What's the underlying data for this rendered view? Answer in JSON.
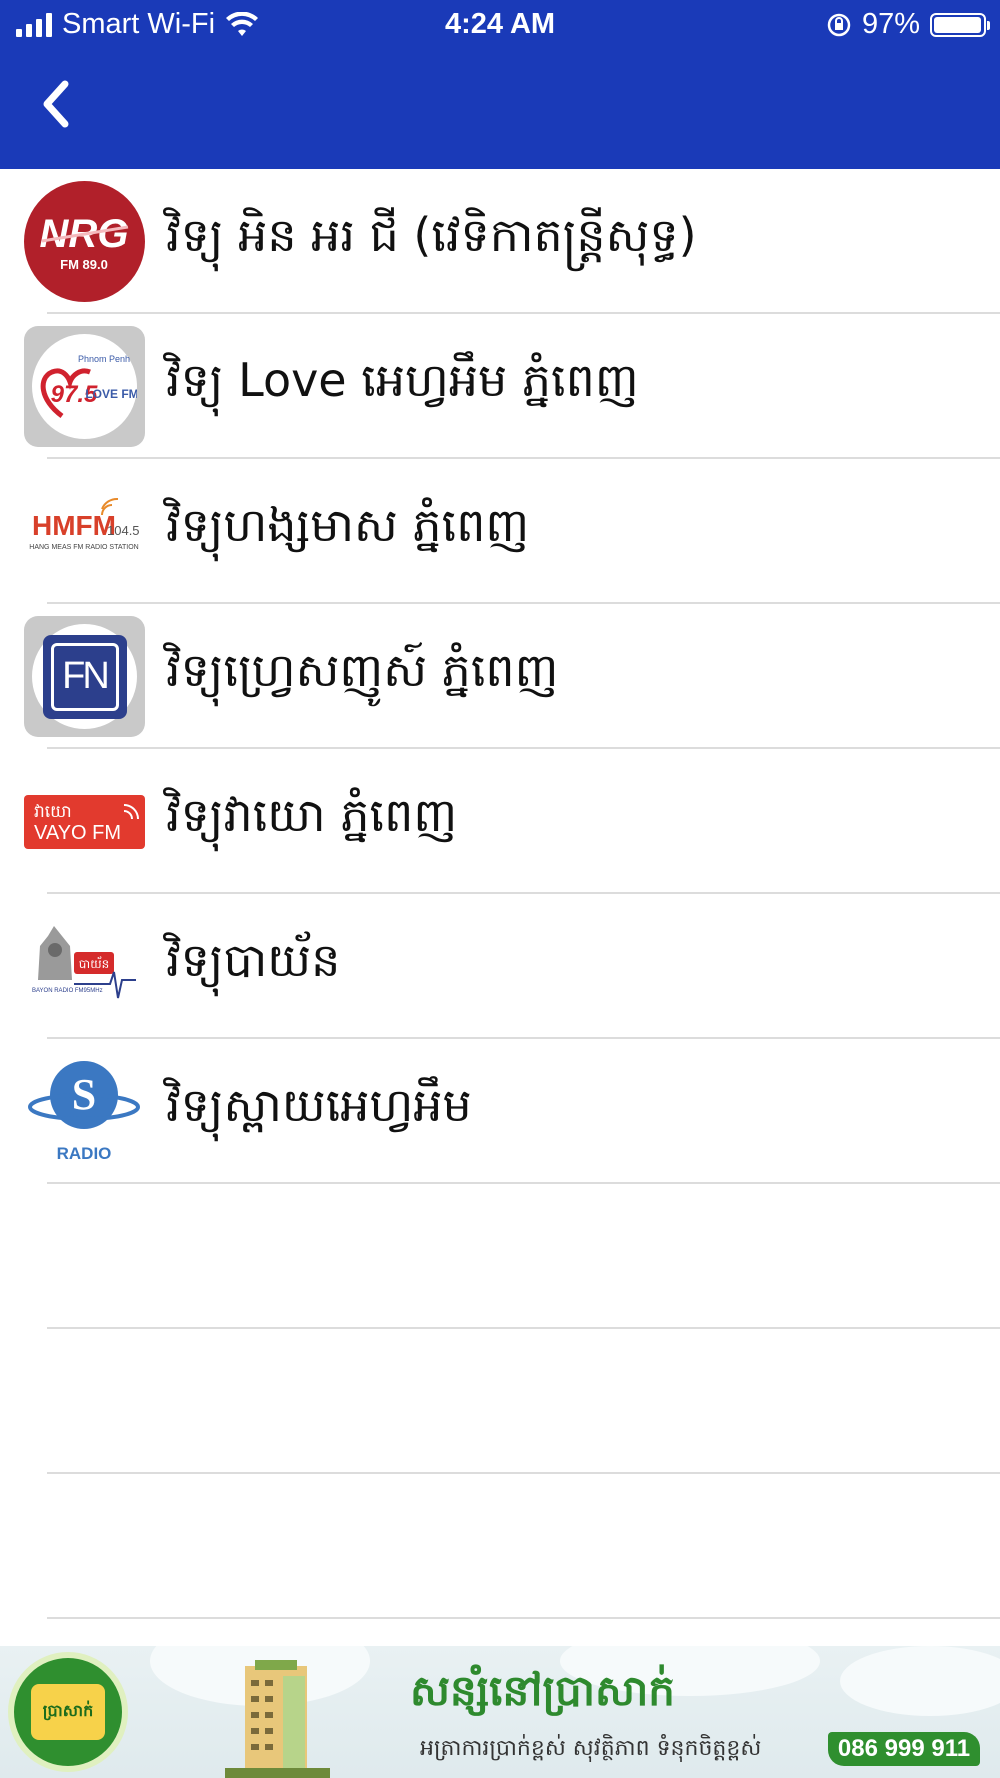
{
  "status_bar": {
    "carrier": "Smart Wi-Fi",
    "time": "4:24 AM",
    "battery_percent": "97%",
    "battery_level": 0.97
  },
  "nav": {
    "back_icon": "chevron-left-icon"
  },
  "stations": [
    {
      "name": "វិទ្យុ អិន អរ ជី (វេទិកាតន្ត្រីសុទ្ធ)",
      "logo_icon": "nrg-logo",
      "logo_text": "NRG",
      "logo_subtext": "FM 89.0"
    },
    {
      "name": "វិទ្យុ Love អេហ្វអឹម ភ្នំពេញ",
      "logo_icon": "love-fm-logo",
      "logo_text": "97.5",
      "logo_subtext": "LOVE FM",
      "logo_top": "Phnom Penh"
    },
    {
      "name": "វិទ្យុហង្សមាស ភ្នំពេញ",
      "logo_icon": "hmfm-logo",
      "logo_text": "HMFM",
      "logo_subtext": "104.5",
      "logo_caption": "HANG MEAS FM RADIO STATION"
    },
    {
      "name": "វិទ្យុហ្វ្រេសញូស៍ ភ្នំពេញ",
      "logo_icon": "fn-logo",
      "logo_text": "FN"
    },
    {
      "name": "វិទ្យុវាយោ ភ្នំពេញ",
      "logo_icon": "vayo-fm-logo",
      "logo_text": "វាយោ",
      "logo_subtext": "VAYO FM"
    },
    {
      "name": "វិទ្យុបាយ័ន",
      "logo_icon": "bayon-radio-logo",
      "logo_text": "បាយ័ន",
      "logo_caption": "BAYON RADIO FM95MHz"
    },
    {
      "name": "វិទ្យុស្ពាយអេហ្វអឹម",
      "logo_icon": "s-radio-logo",
      "logo_text": "S",
      "logo_subtext": "RADIO"
    }
  ],
  "empty_rows": 3,
  "ad": {
    "seal_text": "ប្រាសាក់",
    "headline": "សន្សំនៅប្រាសាក់",
    "tagline": "អត្រាការប្រាក់ខ្ពស់ សុវត្ថិភាព ទំនុកចិត្តខ្ពស់",
    "phone": "086 999 911"
  },
  "colors": {
    "header": "#1a3ab8",
    "separator": "#dcdcdc",
    "ad_green": "#2f8f2f"
  }
}
